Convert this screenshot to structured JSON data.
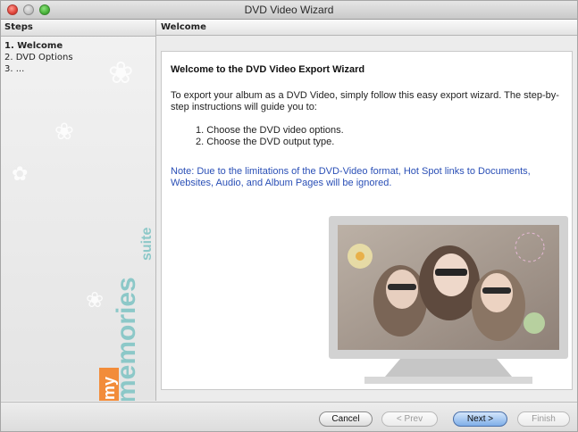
{
  "window": {
    "title": "DVD Video Wizard"
  },
  "sidebar": {
    "header": "Steps",
    "steps": [
      {
        "label": "1. Welcome",
        "active": true
      },
      {
        "label": "2. DVD Options",
        "active": false
      },
      {
        "label": "3. ...",
        "active": false
      }
    ],
    "logo": {
      "prefix": "my",
      "word": "memories",
      "suffix": "suite"
    }
  },
  "main": {
    "header": "Welcome",
    "title": "Welcome to the DVD Video Export Wizard",
    "intro": "To export your album as a DVD Video, simply follow this easy export wizard. The step-by-step instructions will guide you to:",
    "list": [
      "1. Choose the DVD video options.",
      "2. Choose the DVD output type."
    ],
    "note": "Note: Due to the limitations of the DVD-Video format, Hot Spot links to Documents, Websites, Audio, and Album Pages will be ignored."
  },
  "buttons": {
    "cancel": "Cancel",
    "prev": "< Prev",
    "next": "Next >",
    "finish": "Finish"
  },
  "colors": {
    "note_text": "#2a4fb6",
    "logo_teal": "#8cc8c8",
    "logo_orange": "#f28c3a",
    "default_button": "#7faee8"
  }
}
